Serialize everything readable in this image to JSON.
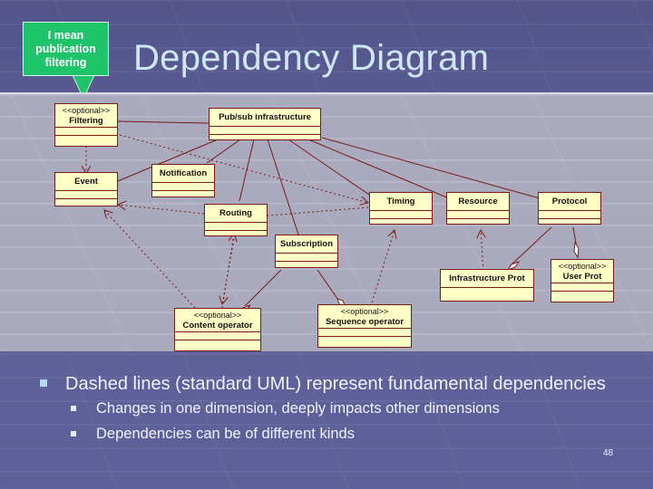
{
  "slide": {
    "title": "Dependency Diagram",
    "callout": "I mean publication filtering",
    "page_number": "48",
    "bullets": [
      {
        "text": "Dashed lines (standard UML) represent fundamental dependencies",
        "sub": [
          "Changes in one dimension, deeply impacts other dimensions",
          "Dependencies can be of different kinds"
        ]
      }
    ]
  },
  "diagram": {
    "classes": {
      "filtering": {
        "stereotype": "<<optional>>",
        "name": "Filtering"
      },
      "pubsub": {
        "name": "Pub/sub infrastructure"
      },
      "notification": {
        "name": "Notification"
      },
      "event": {
        "name": "Event"
      },
      "timing": {
        "name": "Timing"
      },
      "resource": {
        "name": "Resource"
      },
      "protocol": {
        "name": "Protocol"
      },
      "routing": {
        "name": "Routing"
      },
      "subscription": {
        "name": "Subscription"
      },
      "infra_prot": {
        "name": "Infrastructure Prot"
      },
      "user_prot": {
        "stereotype": "<<optional>>",
        "name": "User Prot"
      },
      "content_op": {
        "stereotype": "<<optional>>",
        "name": "Content operator"
      },
      "sequence_op": {
        "stereotype": "<<optional>>",
        "name": "Sequence operator"
      }
    },
    "colors": {
      "line": "#7a1a14",
      "class_fill": "#ffffc6",
      "callout": "#1fc46a"
    }
  }
}
